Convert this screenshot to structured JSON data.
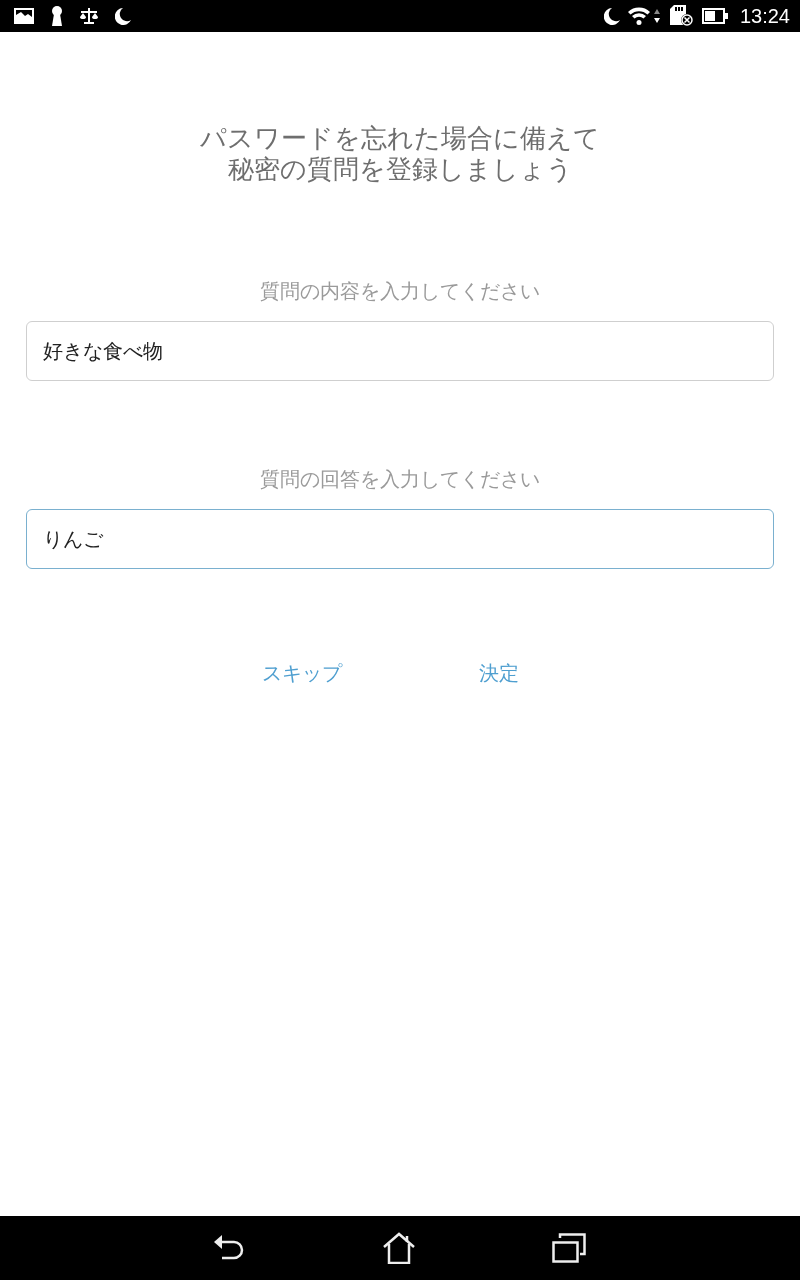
{
  "status_bar": {
    "time": "13:24"
  },
  "heading_lines": [
    "パスワードを忘れた場合に備えて",
    "秘密の質問を登録しましょう"
  ],
  "fields": [
    {
      "label": "質問の内容を入力してください",
      "value": "好きな食べ物",
      "focused": false
    },
    {
      "label": "質問の回答を入力してください",
      "value": "りんご",
      "focused": true
    }
  ],
  "actions": [
    {
      "label": "スキップ"
    },
    {
      "label": "決定"
    }
  ]
}
